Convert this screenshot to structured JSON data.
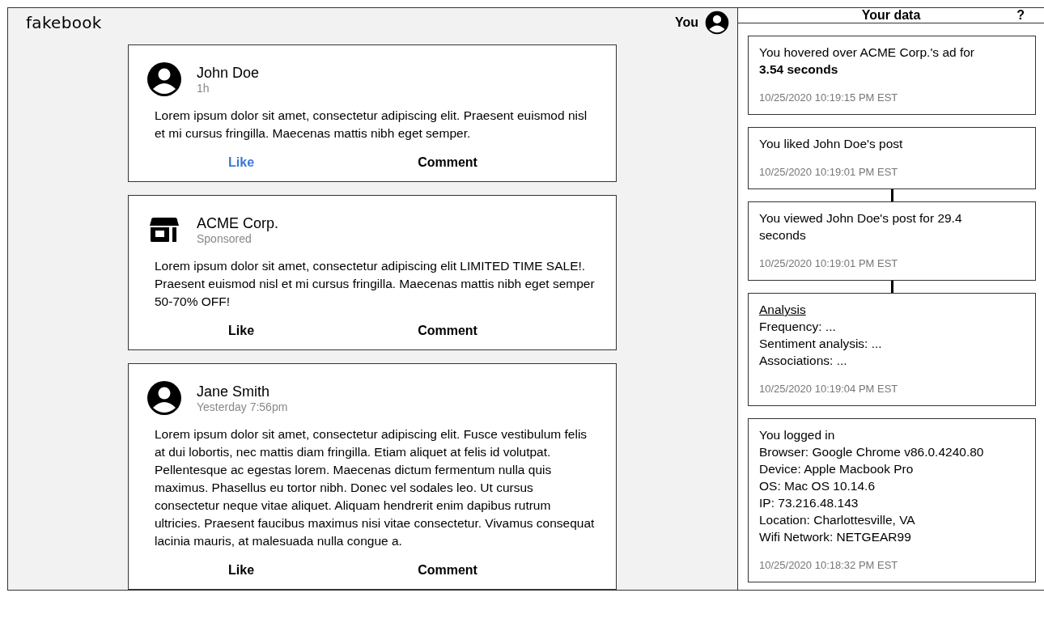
{
  "header": {
    "logo": "fakebook",
    "user_label": "You"
  },
  "posts": [
    {
      "author": "John Doe",
      "kind": "person",
      "meta": "1h",
      "body": "Lorem ipsum dolor sit amet, consectetur adipiscing elit. Praesent euismod nisl et mi cursus fringilla. Maecenas mattis nibh eget semper.",
      "like": "Like",
      "liked": true,
      "comment": "Comment"
    },
    {
      "author": "ACME Corp.",
      "kind": "store",
      "meta": "Sponsored",
      "body": "Lorem ipsum dolor sit amet, consectetur adipiscing elit LIMITED TIME SALE!. Praesent euismod nisl et mi cursus fringilla. Maecenas mattis nibh eget semper 50-70% OFF!",
      "like": "Like",
      "liked": false,
      "comment": "Comment"
    },
    {
      "author": "Jane Smith",
      "kind": "person",
      "meta": "Yesterday 7:56pm",
      "body": "Lorem ipsum dolor sit amet, consectetur adipiscing elit. Fusce vestibulum felis at dui lobortis, nec mattis diam fringilla. Etiam aliquet at felis id volutpat. Pellentesque ac egestas lorem. Maecenas dictum fermentum nulla quis maximus. Phasellus eu tortor nibh. Donec vel sodales leo. Ut cursus consectetur neque vitae aliquet. Aliquam hendrerit enim dapibus rutrum ultricies. Praesent faucibus maximus nisi vitae consectetur. Vivamus consequat lacinia mauris, at malesuada nulla congue a.",
      "like": "Like",
      "liked": false,
      "comment": "Comment"
    }
  ],
  "data_panel": {
    "title": "Your data",
    "help": "?",
    "entries": [
      {
        "text": "You hovered over ACME Corp.'s ad for\n**3.54 seconds**",
        "timestamp": "10/25/2020 10:19:15 PM EST",
        "linked_to_next": false
      },
      {
        "text": "You liked John Doe's post",
        "timestamp": "10/25/2020 10:19:01 PM EST",
        "linked_to_next": true
      },
      {
        "text": "You viewed John Doe's post for 29.4 seconds",
        "timestamp": "10/25/2020 10:19:01 PM EST",
        "linked_to_next": true
      },
      {
        "heading": "Analysis",
        "lines": [
          "Frequency: ...",
          "Sentiment analysis: ...",
          "Associations: ..."
        ],
        "timestamp": "10/25/2020 10:19:04 PM EST",
        "linked_to_next": false
      },
      {
        "lines": [
          "You logged in",
          "Browser: Google Chrome v86.0.4240.80",
          "Device: Apple Macbook Pro",
          "OS: Mac OS 10.14.6",
          "IP: 73.216.48.143",
          "Location: Charlottesville, VA",
          "Wifi Network: NETGEAR99"
        ],
        "timestamp": "10/25/2020 10:18:32 PM EST",
        "linked_to_next": false
      }
    ]
  }
}
